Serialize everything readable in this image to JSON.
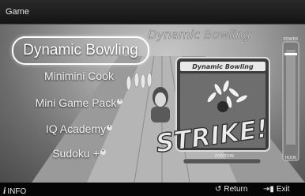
{
  "header": {
    "title": "Game"
  },
  "menu": {
    "items": [
      {
        "label": "Dynamic Bowling",
        "selected": true,
        "badge": false
      },
      {
        "label": "Minimini Cook",
        "selected": false,
        "badge": false
      },
      {
        "label": "Mini Game Pack",
        "selected": false,
        "badge": true
      },
      {
        "label": "IQ Academy",
        "selected": false,
        "badge": true
      },
      {
        "label": "Sudoku +",
        "selected": false,
        "badge": true
      }
    ]
  },
  "preview": {
    "title": "Dynamic Bowling",
    "card_title": "Dynamic Bowling",
    "strike_text": "STRIKE!",
    "power_label": "POWER",
    "hook_label": "HOOK",
    "position_label": "POSITION"
  },
  "footer": {
    "info_label": "INFO",
    "info_icon": "i-icon",
    "return_label": "Return",
    "return_icon": "return-arrow-icon",
    "exit_label": "Exit",
    "exit_icon": "exit-door-icon"
  },
  "colors": {
    "header_bg": "#1e1e1e",
    "footer_bg": "#050505",
    "accent": "#ffffff"
  }
}
